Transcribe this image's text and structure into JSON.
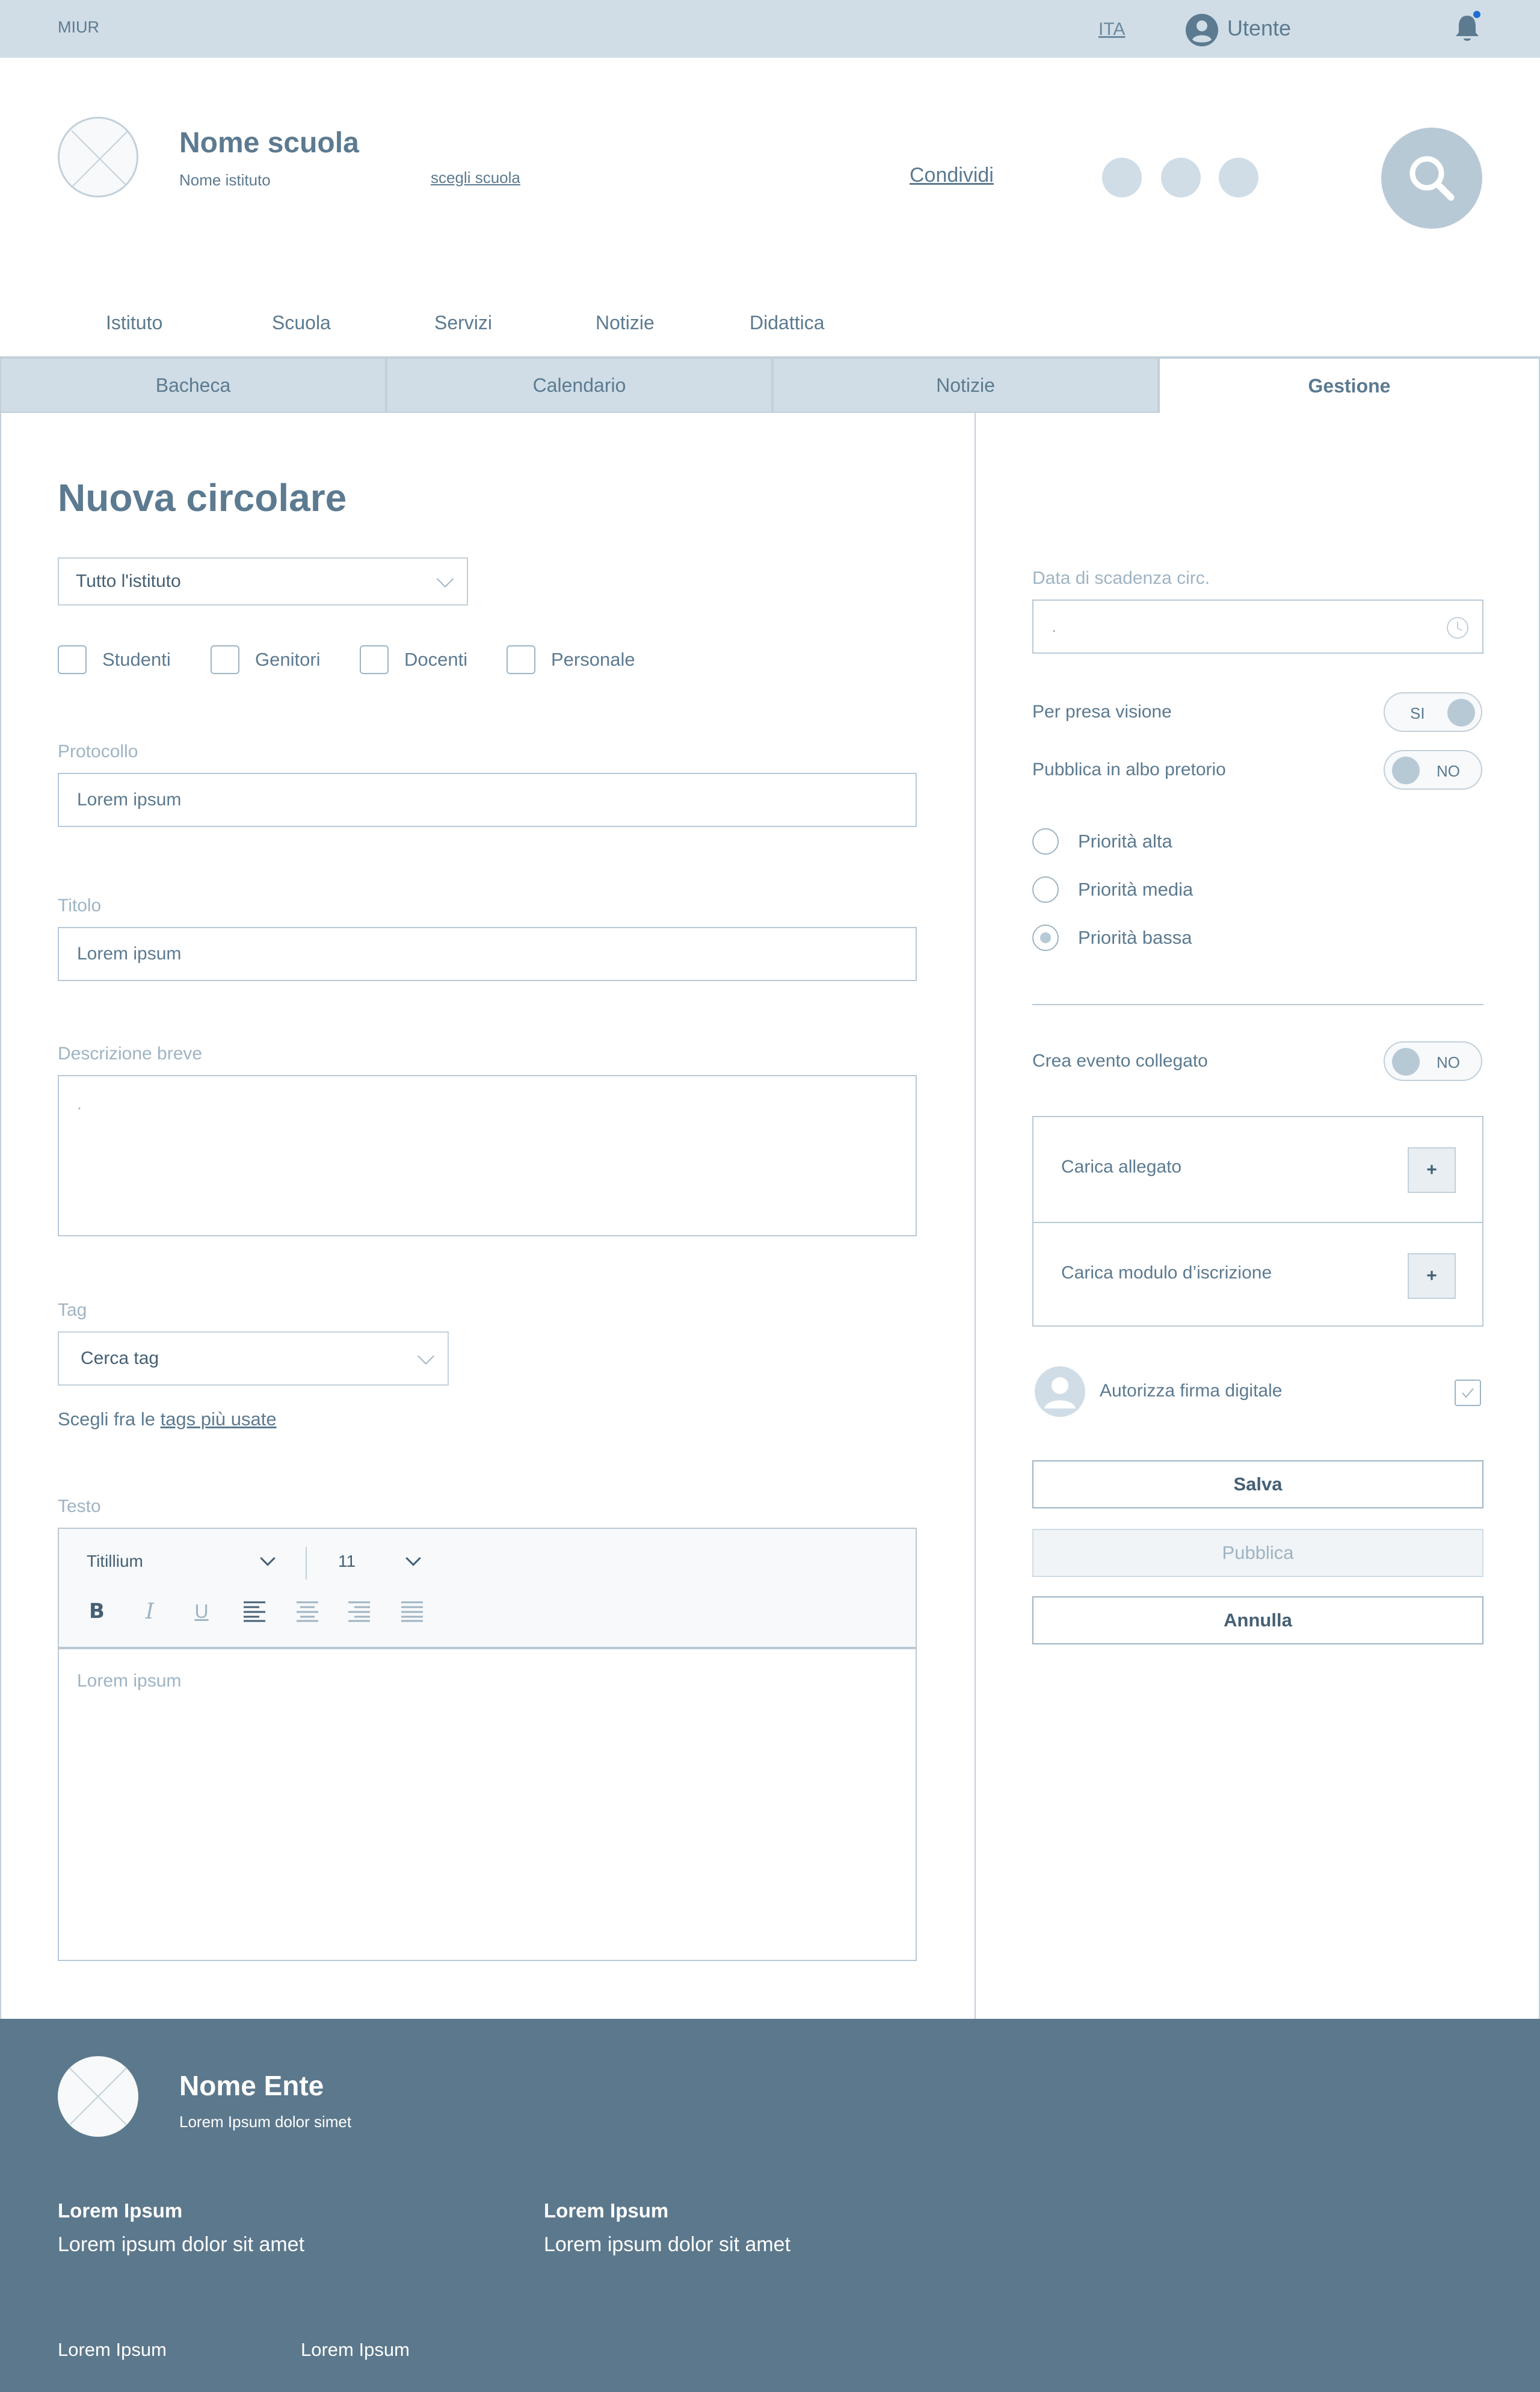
{
  "topbar": {
    "brand": "MIUR",
    "language": "ITA",
    "user": "Utente"
  },
  "header": {
    "school_name": "Nome scuola",
    "institute_name": "Nome istituto",
    "choose_school": "scegli scuola",
    "share": "Condividi"
  },
  "main_nav": [
    "Istituto",
    "Scuola",
    "Servizi",
    "Notizie",
    "Didattica"
  ],
  "tabs": [
    {
      "label": "Bacheca"
    },
    {
      "label": "Calendario"
    },
    {
      "label": "Notizie"
    },
    {
      "label": "Gestione"
    }
  ],
  "form": {
    "title": "Nuova circolare",
    "audience_select": "Tutto l'istituto",
    "recipients": [
      "Studenti",
      "Genitori",
      "Docenti",
      "Personale"
    ],
    "protocol_label": "Protocollo",
    "protocol_value": "Lorem ipsum",
    "title_label": "Titolo",
    "title_value": "Lorem ipsum",
    "description_label": "Descrizione breve",
    "description_value": ".",
    "tag_label": "Tag",
    "tag_select": "Cerca tag",
    "tag_hint_prefix": "Scegli fra le ",
    "tag_hint_link": "tags più usate",
    "text_label": "Testo",
    "editor": {
      "font": "Titillium",
      "size": "11",
      "body": "Lorem ipsum"
    }
  },
  "side": {
    "expiry_label": "Data di scadenza circ.",
    "expiry_value": ".",
    "presa_visione_label": "Per presa visione",
    "presa_visione_toggle": "SI",
    "albo_label": "Pubblica in albo pretorio",
    "albo_toggle": "NO",
    "priorities": [
      "Priorità alta",
      "Priorità media",
      "Priorità bassa"
    ],
    "selected_priority": "Priorità bassa",
    "event_label": "Crea evento collegato",
    "event_toggle": "NO",
    "upload_attachment": "Carica allegato",
    "upload_form": "Carica modulo d’iscrizione",
    "plus": "+",
    "signature_label": "Autorizza firma digitale",
    "save": "Salva",
    "publish": "Pubblica",
    "cancel": "Annulla"
  },
  "footer": {
    "name": "Nome Ente",
    "subtitle": "Lorem Ipsum dolor simet",
    "col1_title": "Lorem Ipsum",
    "col1_text": "Lorem ipsum dolor sit amet",
    "col2_title": "Lorem Ipsum",
    "col2_text": "Lorem ipsum dolor sit amet",
    "link1": "Lorem Ipsum",
    "link2": "Lorem Ipsum"
  },
  "colors": {
    "topbar": "#d0dde6",
    "text": "#5c7a90",
    "footer": "#5c788c",
    "notification_dot": "#1f6fd0"
  }
}
